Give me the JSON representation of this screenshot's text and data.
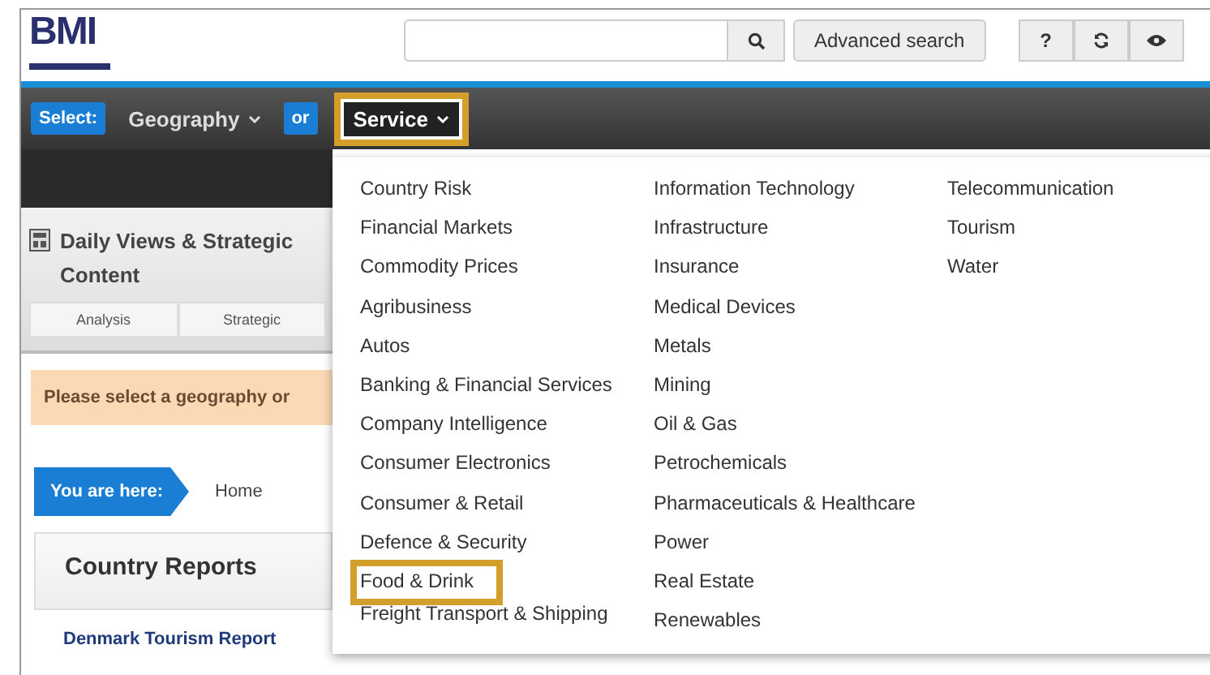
{
  "header": {
    "logo": "BMI",
    "advanced_search": "Advanced search",
    "help": "?"
  },
  "nav": {
    "select_label": "Select:",
    "or_label": "or",
    "selectors": [
      {
        "label": "Geography",
        "highlighted": false
      },
      {
        "label": "Service",
        "highlighted": true
      }
    ]
  },
  "panel": {
    "title": "Daily Views & Strategic Content",
    "tabs": [
      {
        "label": "Analysis"
      },
      {
        "label": "Strategic"
      }
    ]
  },
  "alert": "Please select a geography or",
  "breadcrumb": {
    "label": "You are here:",
    "items": [
      "Home"
    ]
  },
  "card": {
    "title": "Country Reports",
    "link": "Denmark Tourism Report"
  },
  "menu": {
    "columns": [
      [
        {
          "label": "Country Risk",
          "highlighted": false
        },
        {
          "label": "Financial Markets",
          "highlighted": false
        },
        {
          "label": "Commodity Prices",
          "highlighted": false
        },
        {
          "label": "Agribusiness",
          "highlighted": false
        },
        {
          "label": "Autos",
          "highlighted": false
        },
        {
          "label": "Banking & Financial Services",
          "highlighted": false
        },
        {
          "label": "Company Intelligence",
          "highlighted": false
        },
        {
          "label": "Consumer Electronics",
          "highlighted": false
        },
        {
          "label": "Consumer & Retail",
          "highlighted": false
        },
        {
          "label": "Defence & Security",
          "highlighted": false
        },
        {
          "label": "Food & Drink",
          "highlighted": true
        },
        {
          "label": "Freight Transport & Shipping",
          "highlighted": false
        }
      ],
      [
        {
          "label": "Information Technology",
          "highlighted": false
        },
        {
          "label": "Infrastructure",
          "highlighted": false
        },
        {
          "label": "Insurance",
          "highlighted": false
        },
        {
          "label": "Medical Devices",
          "highlighted": false
        },
        {
          "label": "Metals",
          "highlighted": false
        },
        {
          "label": "Mining",
          "highlighted": false
        },
        {
          "label": "Oil & Gas",
          "highlighted": false
        },
        {
          "label": "Petrochemicals",
          "highlighted": false
        },
        {
          "label": "Pharmaceuticals & Healthcare",
          "highlighted": false
        },
        {
          "label": "Power",
          "highlighted": false
        },
        {
          "label": "Real Estate",
          "highlighted": false
        },
        {
          "label": "Renewables",
          "highlighted": false
        }
      ],
      [
        {
          "label": "Telecommunication",
          "highlighted": false
        },
        {
          "label": "Tourism",
          "highlighted": false
        },
        {
          "label": "Water",
          "highlighted": false
        }
      ]
    ]
  }
}
